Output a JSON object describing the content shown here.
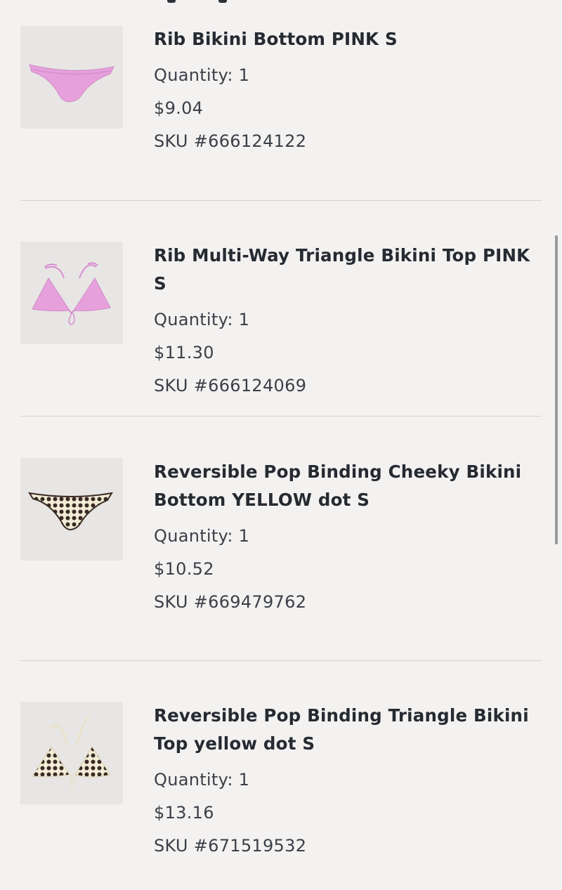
{
  "items": [
    {
      "name": "Rib Bikini Bottom PINK S",
      "quantity": "Quantity: 1",
      "price": "$9.04",
      "sku": "SKU #666124122",
      "image": "pink-bikini-bottom-image"
    },
    {
      "name": "Rib Multi-Way Triangle Bikini Top PINK S",
      "quantity": "Quantity: 1",
      "price": "$11.30",
      "sku": "SKU #666124069",
      "image": "pink-triangle-bikini-top-image"
    },
    {
      "name": "Reversible Pop Binding Cheeky Bikini Bottom YELLOW dot S",
      "quantity": "Quantity: 1",
      "price": "$10.52",
      "sku": "SKU #669479762",
      "image": "polka-dot-bikini-bottom-image"
    },
    {
      "name": "Reversible Pop Binding Triangle Bikini Top yellow dot S",
      "quantity": "Quantity: 1",
      "price": "$13.16",
      "sku": "SKU #671519532",
      "image": "polka-dot-triangle-bikini-top-image"
    }
  ],
  "colors": {
    "background": "#f3f2f1",
    "thumbnail_bg": "#e7e6e4",
    "text_primary": "#262a31",
    "text_secondary": "#3b3f47",
    "divider": "#d4d3d1",
    "pink_fabric": "#e6a1dc",
    "dot_fabric_base": "#f2ecd6",
    "dot_color": "#3a2a24"
  }
}
